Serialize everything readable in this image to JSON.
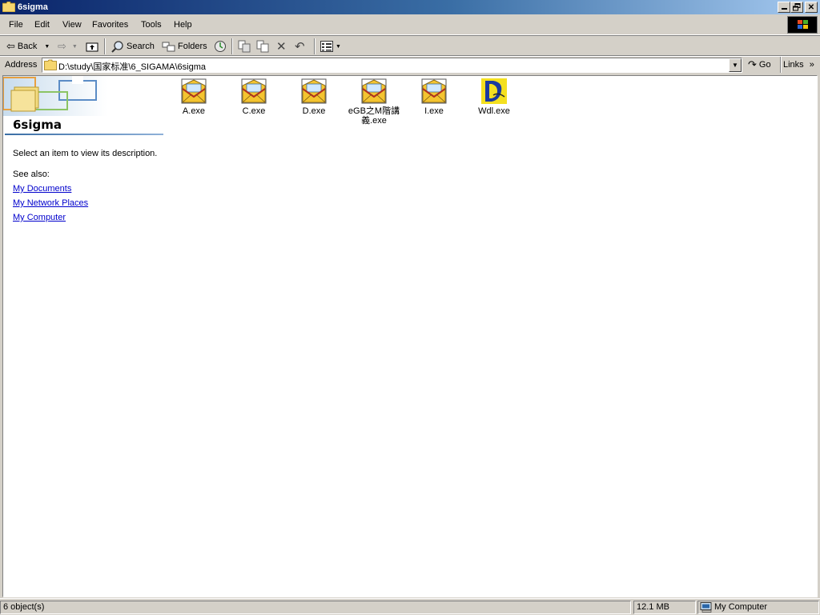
{
  "window": {
    "title": "6sigma"
  },
  "menu": [
    "File",
    "Edit",
    "View",
    "Favorites",
    "Tools",
    "Help"
  ],
  "toolbar": {
    "back_label": "Back",
    "search_label": "Search",
    "folders_label": "Folders"
  },
  "address": {
    "label": "Address",
    "value": "D:\\study\\国家标准\\6_SIGAMA\\6sigma",
    "go_label": "Go",
    "links_label": "Links"
  },
  "left_panel": {
    "folder_name": "6sigma",
    "description": "Select an item to view its description.",
    "see_also_label": "See also:",
    "links": [
      "My Documents",
      "My Network Places",
      "My Computer"
    ]
  },
  "files": [
    {
      "name": "A.exe",
      "icon": "envelope-exe-icon"
    },
    {
      "name": "C.exe",
      "icon": "envelope-exe-icon"
    },
    {
      "name": "D.exe",
      "icon": "envelope-exe-icon"
    },
    {
      "name": "eGB之M階講義.exe",
      "icon": "envelope-exe-icon"
    },
    {
      "name": "I.exe",
      "icon": "envelope-exe-icon"
    },
    {
      "name": "Wdl.exe",
      "icon": "wdl-exe-icon"
    }
  ],
  "status": {
    "objects": "6 object(s)",
    "size": "12.1 MB",
    "zone": "My Computer"
  }
}
